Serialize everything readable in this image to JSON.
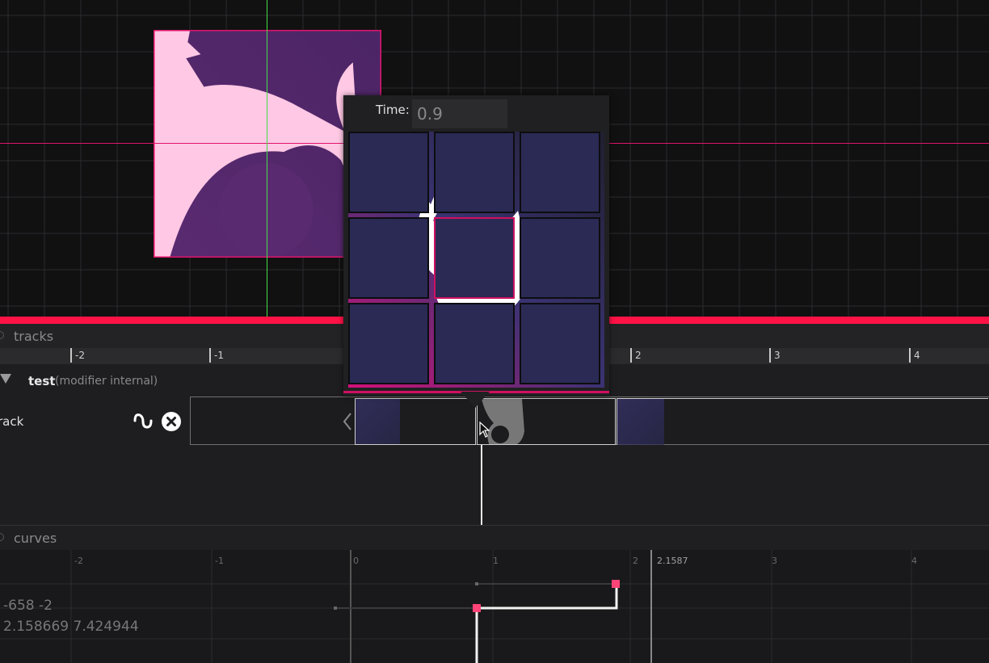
{
  "popup": {
    "time_label": "Time:",
    "time_value": "0.9",
    "grid_rows": 3,
    "grid_cols": 3,
    "selected_cell": 4
  },
  "tracks_panel": {
    "header_label": "tracks",
    "ruler_ticks": [
      "-2",
      "-1",
      "2",
      "3",
      "4"
    ],
    "group": {
      "name": "test",
      "subtitle": "(modifier internal)"
    },
    "track": {
      "label": "rack",
      "icons": [
        "curve-icon",
        "remove-icon"
      ]
    }
  },
  "curves_panel": {
    "header_label": "curves",
    "ticks": [
      "-2",
      "-1",
      "0",
      "1",
      "2",
      "3",
      "4"
    ],
    "cursor_label": "2.1587",
    "readout_line1": "-658 -2",
    "readout_line2": "2.158669 7.424944"
  },
  "colors": {
    "accent": "#ff1246",
    "keyframe": "#ff4477",
    "sprite_pink": "#ffc8e4",
    "sprite_purple": "#5a2a70",
    "guide_green": "#44dd44"
  }
}
